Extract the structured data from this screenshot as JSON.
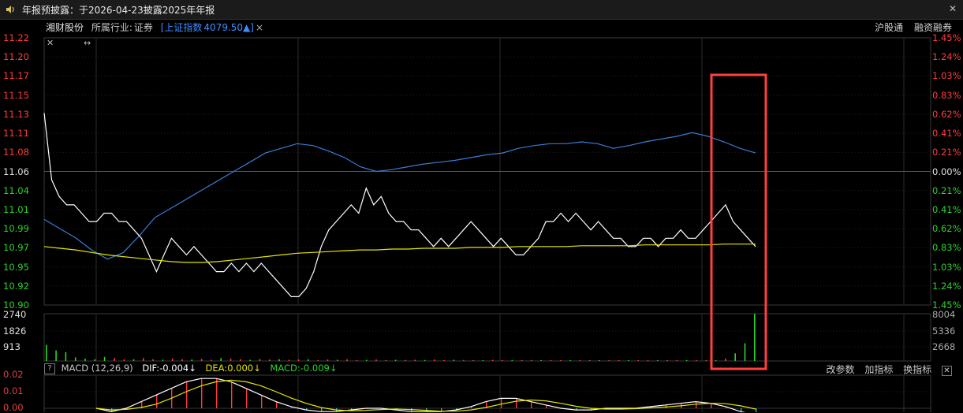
{
  "window": {
    "title": "年报预披露：于2026-04-23披露2025年年报",
    "close_label": "✕"
  },
  "info": {
    "stock_name": "湘财股份",
    "industry_label": "所属行业:",
    "industry": "证券",
    "index_label": "[上证指数",
    "index_value": "4079.50▲]",
    "index_close": "×"
  },
  "right_links": [
    "沪股通",
    "融资融券"
  ],
  "price_axis_left": [
    "11.22",
    "11.20",
    "11.17",
    "11.15",
    "11.13",
    "11.11",
    "11.08",
    "11.06",
    "11.04",
    "11.01",
    "10.99",
    "10.97",
    "10.95",
    "10.92",
    "10.90"
  ],
  "price_axis_right": [
    "1.45%",
    "1.24%",
    "1.03%",
    "0.83%",
    "0.62%",
    "0.41%",
    "0.21%",
    "0.00%",
    "0.21%",
    "0.41%",
    "0.62%",
    "0.83%",
    "1.03%",
    "1.24%",
    "1.45%"
  ],
  "volume_axis_left": [
    "2740",
    "1826",
    "913"
  ],
  "volume_axis_right": [
    "8004",
    "5336",
    "2668"
  ],
  "macd": {
    "help": "?",
    "name": "MACD (12,26,9)",
    "dif": "DIF:-0.004↓",
    "dea": "DEA:0.000↓",
    "macd": "MACD:-0.009↓",
    "axis": [
      "0.02",
      "0.01",
      "0.00"
    ],
    "tools": [
      "改参数",
      "加指标",
      "换指标"
    ],
    "close": "✕"
  },
  "colors": {
    "up": "#ff3b3b",
    "down": "#2bd42b",
    "price_line": "#ffffff",
    "avg_line": "#e6e600",
    "index_line": "#3a7bd5",
    "highlight": "#ff4040",
    "index_text": "#3e8cff"
  },
  "chart_data": {
    "type": "line",
    "title": "",
    "ylim": [
      10.9,
      11.22
    ],
    "price": [
      11.13,
      11.05,
      11.03,
      11.02,
      11.02,
      11.01,
      11.0,
      11.0,
      11.01,
      11.01,
      11.0,
      11.0,
      10.99,
      10.98,
      10.96,
      10.94,
      10.96,
      10.98,
      10.97,
      10.96,
      10.97,
      10.96,
      10.95,
      10.94,
      10.94,
      10.95,
      10.94,
      10.95,
      10.94,
      10.95,
      10.94,
      10.93,
      10.92,
      10.91,
      10.91,
      10.92,
      10.94,
      10.97,
      10.99,
      11.0,
      11.01,
      11.02,
      11.01,
      11.04,
      11.02,
      11.03,
      11.01,
      11.0,
      11.0,
      10.99,
      10.99,
      10.98,
      10.97,
      10.98,
      10.97,
      10.98,
      10.99,
      11.0,
      10.99,
      10.98,
      10.97,
      10.98,
      10.97,
      10.96,
      10.96,
      10.97,
      10.98,
      11.0,
      11.0,
      11.01,
      11.0,
      11.01,
      11.0,
      10.99,
      11.0,
      10.99,
      10.98,
      10.98,
      10.97,
      10.97,
      10.98,
      10.98,
      10.97,
      10.98,
      10.98,
      10.99,
      10.98,
      10.98,
      10.99,
      11.0,
      11.01,
      11.02,
      11.0,
      10.99,
      10.98,
      10.97
    ],
    "avg": [
      10.97,
      10.968,
      10.966,
      10.963,
      10.96,
      10.958,
      10.956,
      10.954,
      10.952,
      10.951,
      10.951,
      10.952,
      10.954,
      10.956,
      10.958,
      10.96,
      10.962,
      10.963,
      10.964,
      10.965,
      10.966,
      10.966,
      10.967,
      10.967,
      10.968,
      10.968,
      10.968,
      10.969,
      10.969,
      10.969,
      10.97,
      10.97,
      10.97,
      10.97,
      10.971,
      10.971,
      10.971,
      10.971,
      10.972,
      10.972,
      10.972,
      10.972,
      10.972,
      10.973,
      10.973,
      10.973
    ],
    "index_pct": [
      -0.52,
      -0.62,
      -0.72,
      -0.85,
      -0.95,
      -0.88,
      -0.7,
      -0.5,
      -0.4,
      -0.3,
      -0.2,
      -0.1,
      0.0,
      0.1,
      0.2,
      0.25,
      0.3,
      0.28,
      0.22,
      0.15,
      0.05,
      0.0,
      0.02,
      0.05,
      0.08,
      0.1,
      0.12,
      0.15,
      0.18,
      0.2,
      0.25,
      0.28,
      0.3,
      0.3,
      0.32,
      0.3,
      0.25,
      0.28,
      0.32,
      0.35,
      0.38,
      0.42,
      0.38,
      0.32,
      0.25,
      0.2
    ],
    "volume": [
      2740,
      1800,
      1500,
      600,
      400,
      300,
      700,
      500,
      250,
      300,
      500,
      300,
      200,
      400,
      300,
      250,
      350,
      200,
      500,
      400,
      300,
      200,
      350,
      250,
      300,
      200,
      250,
      300,
      150,
      250,
      200,
      300,
      150,
      200,
      250,
      150,
      200,
      180,
      220,
      180,
      260,
      150,
      200,
      180,
      150,
      120,
      200,
      150,
      180,
      130,
      160,
      120,
      150,
      130,
      140,
      120,
      100,
      130,
      110,
      150,
      120,
      100,
      130,
      110,
      120,
      100,
      90,
      110,
      130,
      120,
      400,
      1300,
      3000,
      8004
    ],
    "macd_dif": [
      0.0,
      -0.002,
      0.0,
      0.004,
      0.008,
      0.012,
      0.016,
      0.018,
      0.018,
      0.016,
      0.012,
      0.008,
      0.004,
      0.001,
      -0.001,
      -0.002,
      -0.002,
      -0.001,
      0.0,
      0.0,
      -0.001,
      -0.002,
      -0.002,
      -0.002,
      -0.001,
      0.001,
      0.004,
      0.006,
      0.006,
      0.004,
      0.002,
      0.0,
      -0.001,
      -0.001,
      0.0,
      0.0,
      0.0,
      0.001,
      0.002,
      0.003,
      0.004,
      0.003,
      0.001,
      -0.002,
      -0.004
    ]
  }
}
